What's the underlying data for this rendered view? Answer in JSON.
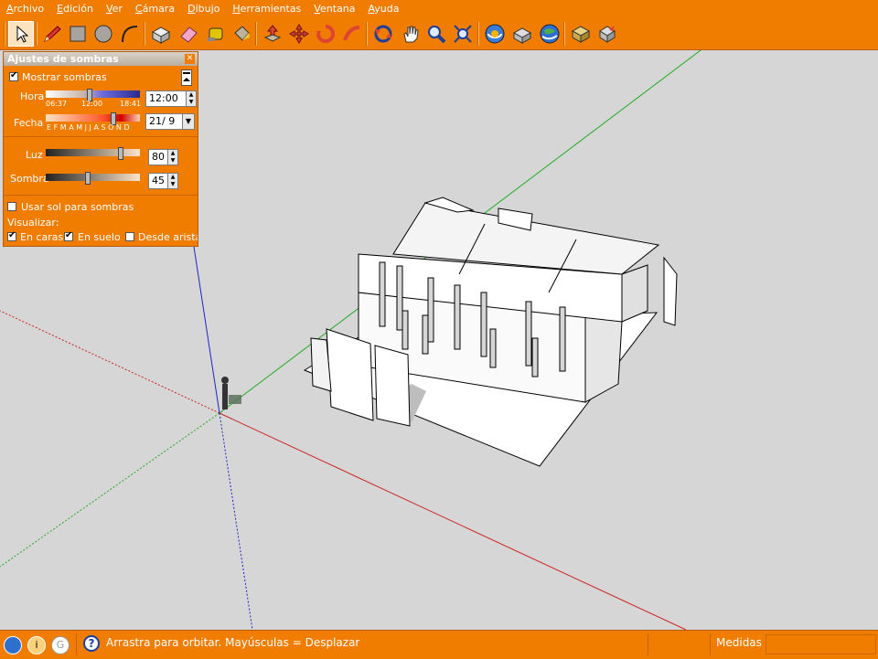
{
  "menu": [
    "Archivo",
    "Edición",
    "Ver",
    "Cámara",
    "Dibujo",
    "Herramientas",
    "Ventana",
    "Ayuda"
  ],
  "shadow_panel": {
    "title": "Ajustes de sombras",
    "show_shadows": {
      "label": "Mostrar sombras",
      "checked": true
    },
    "hora": {
      "label": "Hora",
      "value": "12:00",
      "ticks": [
        "06:37",
        "12:00",
        "18:41"
      ]
    },
    "fecha": {
      "label": "Fecha",
      "value": "21/ 9",
      "months": "E F M A M J J A S O N D"
    },
    "luz": {
      "label": "Luz",
      "value": "80"
    },
    "sombra": {
      "label": "Sombra",
      "value": "45"
    },
    "use_sun": {
      "label": "Usar sol para sombras",
      "checked": false
    },
    "visualizar": {
      "label": "Visualizar:"
    },
    "en_caras": {
      "label": "En caras",
      "checked": true
    },
    "en_suelo": {
      "label": "En suelo",
      "checked": true
    },
    "desde_aristas": {
      "label": "Desde aristas",
      "checked": false
    }
  },
  "status": {
    "hint": "Arrastra para orbitar. Mayúsculas = Desplazar",
    "measure_label": "Medidas",
    "measure_value": ""
  },
  "colors": {
    "accent": "#f07c00",
    "viewport": "#d6d6d6",
    "axis_red": "#cc2222",
    "axis_green": "#22aa22",
    "axis_blue": "#2222cc"
  },
  "toolbar_icons": [
    "select-icon",
    "pencil-icon",
    "rectangle-icon",
    "circle-icon",
    "arc-icon",
    "make-component-icon",
    "eraser-icon",
    "tape-measure-icon",
    "paint-bucket-icon",
    "push-pull-icon",
    "move-icon",
    "rotate-icon",
    "follow-me-icon",
    "orbit-icon",
    "pan-icon",
    "zoom-icon",
    "zoom-extents-icon",
    "get-models-icon",
    "share-model-icon",
    "google-earth-icon",
    "component-icon",
    "export-icon"
  ]
}
